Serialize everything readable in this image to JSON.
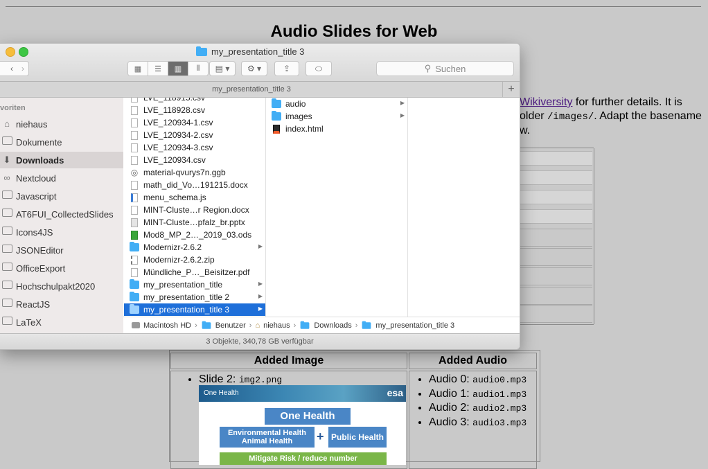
{
  "page": {
    "title": "Audio Slides for Web",
    "para_link": "Wikiversity",
    "para_line1": " for further details. It is",
    "para_line2_pre": "older ",
    "para_code": "/images/",
    "para_line2_post": ". Adapt the basename",
    "para_line3": "w."
  },
  "table": {
    "head_image": "Added Image",
    "head_audio": "Added Audio",
    "slide_label": "Slide 2: ",
    "slide_file": "img2.png",
    "slide_img": {
      "brand_left": "One Health",
      "brand_right": "esa",
      "heading": "One Health",
      "box_left": "Environmental Health\nAnimal Health",
      "plus": "+",
      "box_right": "Public Health",
      "bottom": "Mitigate Risk / reduce number"
    },
    "audios": [
      {
        "label": "Audio 0: ",
        "file": "audio0.mp3"
      },
      {
        "label": "Audio 1: ",
        "file": "audio1.mp3"
      },
      {
        "label": "Audio 2: ",
        "file": "audio2.mp3"
      },
      {
        "label": "Audio 3: ",
        "file": "audio3.mp3"
      }
    ]
  },
  "finder": {
    "window_title": "my_presentation_title 3",
    "tab_title": "my_presentation_title 3",
    "search_placeholder": "Suchen",
    "sidebar_heading": "voriten",
    "sidebar": [
      {
        "label": "niehaus",
        "icon": "home-icon"
      },
      {
        "label": "Dokumente",
        "icon": "folder-icon"
      },
      {
        "label": "Downloads",
        "icon": "download-icon",
        "selected": true
      },
      {
        "label": "Nextcloud",
        "icon": "cloud-icon"
      },
      {
        "label": "Javascript",
        "icon": "folder-icon"
      },
      {
        "label": "AT6FUI_CollectedSlides",
        "icon": "folder-icon"
      },
      {
        "label": "Icons4JS",
        "icon": "folder-icon"
      },
      {
        "label": "JSONEditor",
        "icon": "folder-icon"
      },
      {
        "label": "OfficeExport",
        "icon": "folder-icon"
      },
      {
        "label": "Hochschulpakt2020",
        "icon": "folder-icon"
      },
      {
        "label": "ReactJS",
        "icon": "folder-icon"
      },
      {
        "label": "LaTeX",
        "icon": "folder-icon"
      }
    ],
    "column1": [
      {
        "name": "LVE_118915.csv",
        "kind": "doc"
      },
      {
        "name": "LVE_118928.csv",
        "kind": "doc"
      },
      {
        "name": "LVE_120934-1.csv",
        "kind": "doc"
      },
      {
        "name": "LVE_120934-2.csv",
        "kind": "doc"
      },
      {
        "name": "LVE_120934-3.csv",
        "kind": "doc"
      },
      {
        "name": "LVE_120934.csv",
        "kind": "doc"
      },
      {
        "name": "material-qvurys7n.ggb",
        "kind": "ggb"
      },
      {
        "name": "math_did_Vo…191215.docx",
        "kind": "doc"
      },
      {
        "name": "menu_schema.js",
        "kind": "js"
      },
      {
        "name": "MINT-Cluste…r Region.docx",
        "kind": "doc"
      },
      {
        "name": "MINT-Cluste…pfalz_br.pptx",
        "kind": "pptx"
      },
      {
        "name": "Mod8_MP_2…_2019_03.ods",
        "kind": "ods"
      },
      {
        "name": "Modernizr-2.6.2",
        "kind": "folder",
        "arrow": true
      },
      {
        "name": "Modernizr-2.6.2.zip",
        "kind": "zip"
      },
      {
        "name": "Mündliche_P…_Beisitzer.pdf",
        "kind": "doc"
      },
      {
        "name": "my_presentation_title",
        "kind": "folder",
        "arrow": true
      },
      {
        "name": "my_presentation_title 2",
        "kind": "folder",
        "arrow": true
      },
      {
        "name": "my_presentation_title 3",
        "kind": "folder",
        "arrow": true,
        "selected": true
      }
    ],
    "column2": [
      {
        "name": "audio",
        "kind": "folder",
        "arrow": true
      },
      {
        "name": "images",
        "kind": "folder",
        "arrow": true
      },
      {
        "name": "index.html",
        "kind": "html"
      }
    ],
    "path": [
      "Macintosh HD",
      "Benutzer",
      "niehaus",
      "Downloads",
      "my_presentation_title 3"
    ],
    "status": "3 Objekte, 340,78 GB verfügbar"
  },
  "colors": {
    "selection": "#1e6fd9",
    "folder": "#42aef5",
    "link": "#4b1a7f"
  }
}
